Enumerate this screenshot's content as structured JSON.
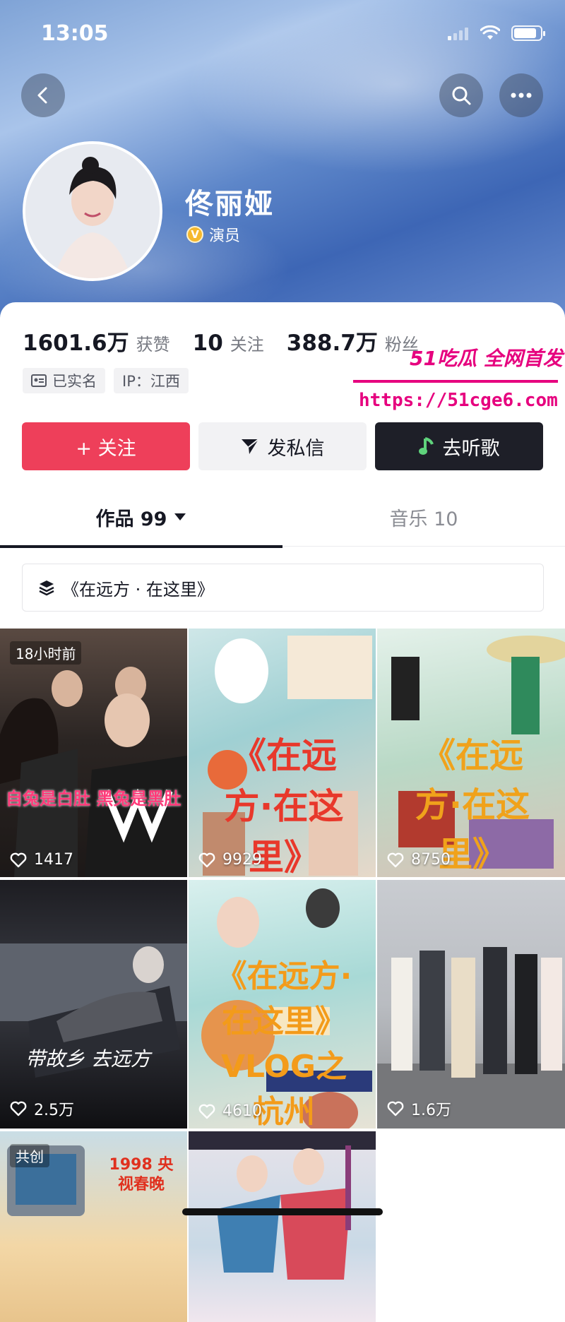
{
  "status_bar": {
    "time": "13:05"
  },
  "profile": {
    "name": "佟丽娅",
    "verified_badge": "V",
    "verified_label": "演员"
  },
  "stats": [
    {
      "value": "1601.6万",
      "label": "获赞"
    },
    {
      "value": "10",
      "label": "关注"
    },
    {
      "value": "388.7万",
      "label": "粉丝"
    }
  ],
  "tags": [
    {
      "label": "已实名",
      "icon": "id-card-icon"
    },
    {
      "label": "IP：江西",
      "icon": ""
    }
  ],
  "watermark": {
    "title": "51吃瓜 全网首发",
    "url": "https://51cge6.com"
  },
  "actions": {
    "follow": "+ 关注",
    "message": "发私信",
    "music": "去听歌"
  },
  "tabs": [
    {
      "label": "作品 99",
      "active": true
    },
    {
      "label": "音乐 10",
      "active": false
    }
  ],
  "collection": {
    "label": "《在远方 · 在这里》"
  },
  "videos": [
    {
      "likes": "1417",
      "badge": "18小时前",
      "caption": "自兔是白肚 黑兔是黑肚"
    },
    {
      "likes": "9929",
      "badge": "",
      "caption": "《在远方·在这里》VLOG之 南京"
    },
    {
      "likes": "8750",
      "badge": "",
      "caption": "《在远方·在这里》VLOG之 苏州"
    },
    {
      "likes": "2.5万",
      "badge": "",
      "caption": "带故乡 去远方"
    },
    {
      "likes": "4610",
      "badge": "",
      "caption": "《在远方·在这里》VLOG之 杭州"
    },
    {
      "likes": "1.6万",
      "badge": "",
      "caption": ""
    },
    {
      "likes": "",
      "badge": "共创",
      "caption": "1998 央视春晚"
    },
    {
      "likes": "",
      "badge": "",
      "caption": ""
    }
  ],
  "colors": {
    "follow_button": "#ee3f5a",
    "music_button": "#1e1f28",
    "watermark": "#e6007e",
    "verified": "#f5b82e"
  }
}
